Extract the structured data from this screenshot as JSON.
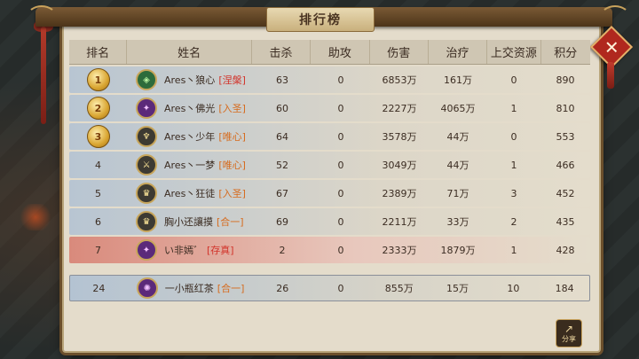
{
  "title": "排行榜",
  "columns": [
    "排名",
    "姓名",
    "击杀",
    "助攻",
    "伤害",
    "治疗",
    "上交资源",
    "积分"
  ],
  "colors": {
    "realm_nirvana": "#d2332a",
    "realm_other": "#d66a1c"
  },
  "rows": [
    {
      "rank": "1",
      "medal": true,
      "icon": "jade-emblem-icon",
      "name": "Ares丶狼心",
      "realm": "[涅槃]",
      "realm_color": "#d2332a",
      "kills": "63",
      "assists": "0",
      "damage": "6853万",
      "heal": "161万",
      "resources": "0",
      "points": "890"
    },
    {
      "rank": "2",
      "medal": true,
      "icon": "purple-blade-icon",
      "name": "Ares丶佛光",
      "realm": "[入圣]",
      "realm_color": "#d66a1c",
      "kills": "60",
      "assists": "0",
      "damage": "2227万",
      "heal": "4065万",
      "resources": "1",
      "points": "810"
    },
    {
      "rank": "3",
      "medal": true,
      "icon": "staff-icon",
      "name": "Ares丶少年",
      "realm": "[唯心]",
      "realm_color": "#d66a1c",
      "kills": "64",
      "assists": "0",
      "damage": "3578万",
      "heal": "44万",
      "resources": "0",
      "points": "553"
    },
    {
      "rank": "4",
      "medal": false,
      "icon": "sword-icon",
      "name": "Ares丶一梦",
      "realm": "[唯心]",
      "realm_color": "#d66a1c",
      "kills": "52",
      "assists": "0",
      "damage": "3049万",
      "heal": "44万",
      "resources": "1",
      "points": "466"
    },
    {
      "rank": "5",
      "medal": false,
      "icon": "helm-icon",
      "name": "Ares丶狂徒",
      "realm": "[入圣]",
      "realm_color": "#d66a1c",
      "kills": "67",
      "assists": "0",
      "damage": "2389万",
      "heal": "71万",
      "resources": "3",
      "points": "452"
    },
    {
      "rank": "6",
      "medal": false,
      "icon": "helm-icon",
      "name": "胸小还讓摸",
      "realm": "[合一]",
      "realm_color": "#d66a1c",
      "kills": "69",
      "assists": "0",
      "damage": "2211万",
      "heal": "33万",
      "resources": "2",
      "points": "435"
    },
    {
      "rank": "7",
      "medal": false,
      "icon": "purple-blade-icon",
      "name": "い非嫣゛",
      "realm": "[存真]",
      "realm_color": "#d2332a",
      "kills": "2",
      "assists": "0",
      "damage": "2333万",
      "heal": "1879万",
      "resources": "1",
      "points": "428"
    }
  ],
  "self_row": {
    "rank": "24",
    "icon": "purple-orb-icon",
    "name": "一小瓶红茶",
    "realm": "[合一]",
    "realm_color": "#d66a1c",
    "kills": "26",
    "assists": "0",
    "damage": "855万",
    "heal": "15万",
    "resources": "10",
    "points": "184"
  },
  "share_label": "分享"
}
